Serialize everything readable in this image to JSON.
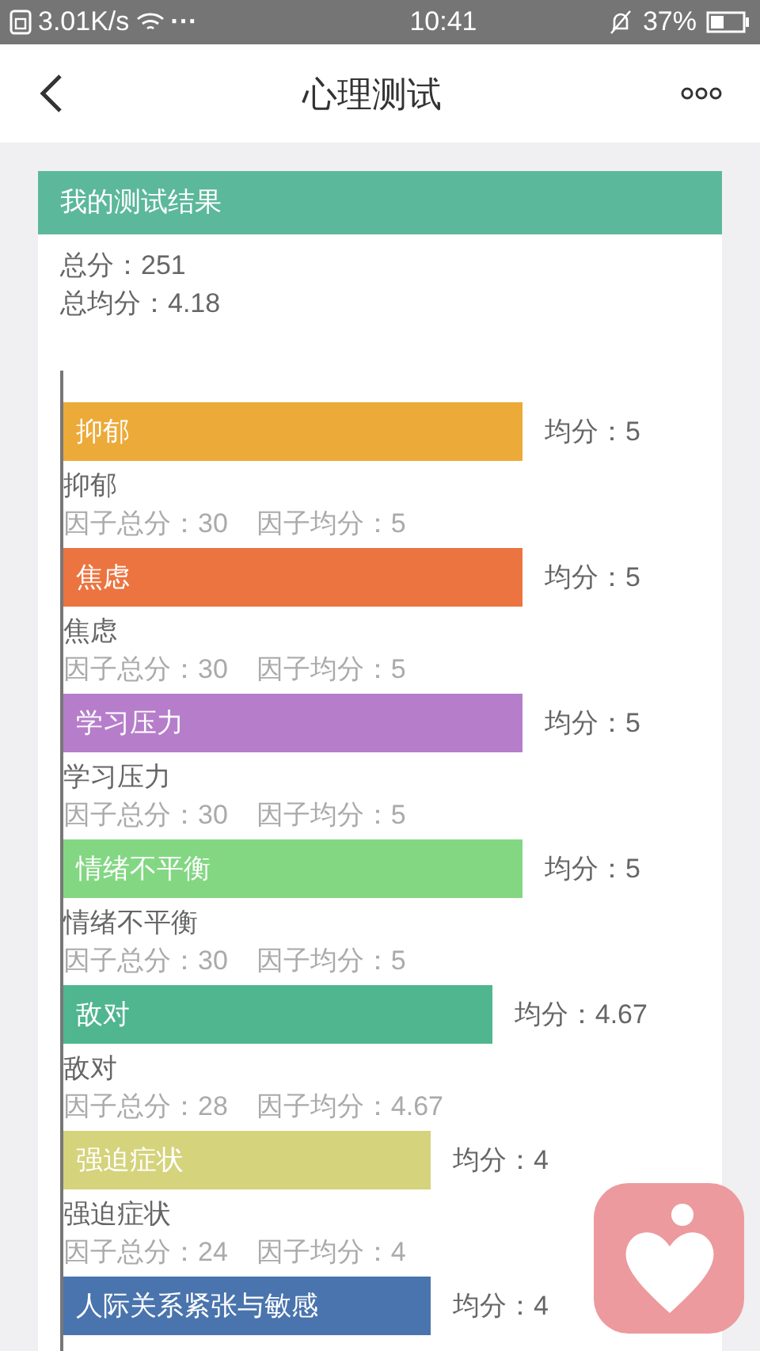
{
  "status_bar": {
    "speed": "3.01K/s",
    "dots": "···",
    "time": "10:41",
    "battery": "37%"
  },
  "header": {
    "title": "心理测试"
  },
  "card": {
    "title": "我的测试结果",
    "total": "总分：251",
    "average": "总均分：4.18",
    "factors": [
      {
        "label": "抑郁",
        "color": "#ecaa38",
        "level": 1,
        "avg": "均分：5",
        "name": "抑郁",
        "total": "因子总分：30",
        "factor_avg": "因子均分：5"
      },
      {
        "label": "焦虑",
        "color": "#ec7440",
        "level": 1,
        "avg": "均分：5",
        "name": "焦虑",
        "total": "因子总分：30",
        "factor_avg": "因子均分：5"
      },
      {
        "label": "学习压力",
        "color": "#b67dca",
        "level": 1,
        "avg": "均分：5",
        "name": "学习压力",
        "total": "因子总分：30",
        "factor_avg": "因子均分：5"
      },
      {
        "label": "情绪不平衡",
        "color": "#83d783",
        "level": 1,
        "avg": "均分：5",
        "name": "情绪不平衡",
        "total": "因子总分：30",
        "factor_avg": "因子均分：5"
      },
      {
        "label": "敌对",
        "color": "#50b68f",
        "level": 0.934,
        "avg": "均分：4.67",
        "name": "敌对",
        "total": "因子总分：28",
        "factor_avg": "因子均分：4.67"
      },
      {
        "label": "强迫症状",
        "color": "#d5d37c",
        "level": 0.8,
        "avg": "均分：4",
        "name": "强迫症状",
        "total": "因子总分：24",
        "factor_avg": "因子均分：4"
      },
      {
        "label": "人际关系紧张与敏感",
        "color": "#4a74ad",
        "level": 0.8,
        "avg": "均分：4"
      }
    ]
  }
}
